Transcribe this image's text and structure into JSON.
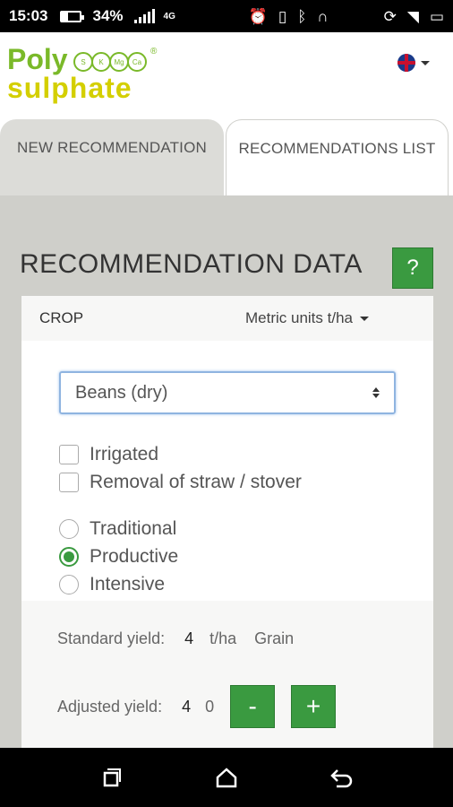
{
  "status_bar": {
    "time": "15:03",
    "battery_percent_text": "34%",
    "battery_level": 0.34,
    "network_label": "4G"
  },
  "header": {
    "logo_top": "Poly",
    "logo_bottom": "sulphate",
    "logo_circles": [
      "S",
      "K",
      "Mg",
      "Ca"
    ],
    "logo_reg": "®"
  },
  "tabs": [
    {
      "label": "NEW RECOMMENDATION",
      "active": true
    },
    {
      "label": "RECOMMENDATIONS LIST",
      "active": false
    }
  ],
  "section": {
    "title": "RECOMMENDATION DATA",
    "help_label": "?"
  },
  "crop_card": {
    "heading": "CROP",
    "units_label": "Metric units t/ha",
    "crop_select_value": "Beans (dry)",
    "checkboxes": [
      {
        "label": "Irrigated",
        "checked": false
      },
      {
        "label": "Removal of straw / stover",
        "checked": false
      }
    ],
    "radios": [
      {
        "label": "Traditional",
        "checked": false
      },
      {
        "label": "Productive",
        "checked": true
      },
      {
        "label": "Intensive",
        "checked": false
      }
    ]
  },
  "yield": {
    "standard_label": "Standard yield:",
    "standard_value": "4",
    "standard_unit": "t/ha",
    "standard_type": "Grain",
    "adjusted_label": "Adjusted yield:",
    "adjusted_value": "4",
    "adjusted_decimal": "0",
    "minus_label": "-",
    "plus_label": "+"
  },
  "colors": {
    "brand_green": "#3a9a40",
    "logo_green": "#7ab929",
    "logo_yellow": "#d4cf00"
  }
}
